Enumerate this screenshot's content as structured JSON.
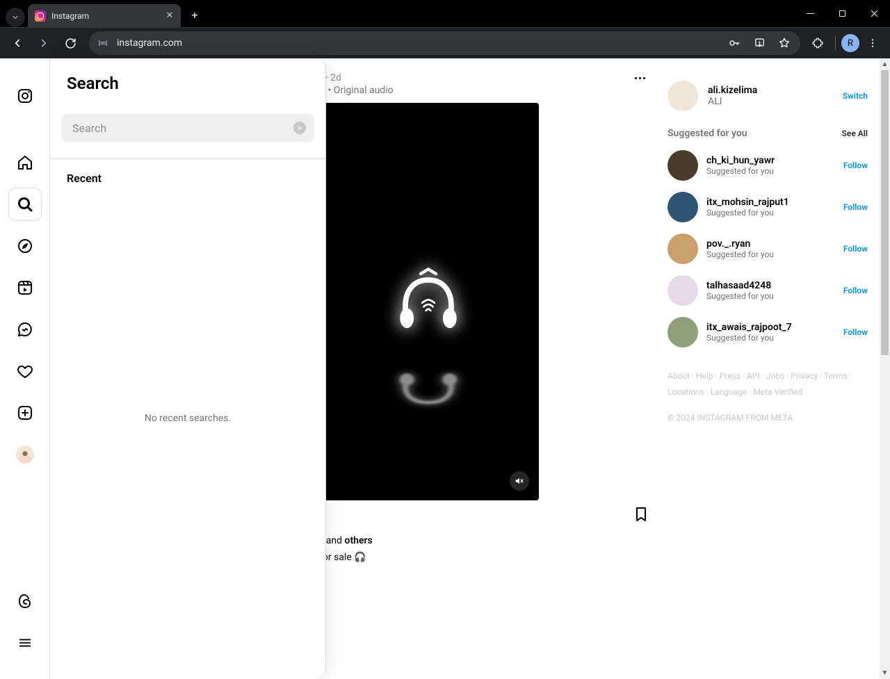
{
  "browser": {
    "tab_title": "Instagram",
    "url": "instagram.com",
    "profile_letter": "R"
  },
  "search_panel": {
    "title": "Search",
    "placeholder": "Search",
    "recent_title": "Recent",
    "no_recent": "No recent searches."
  },
  "post": {
    "time": "2d",
    "audio": "Original audio",
    "likes_tail": "and ",
    "likes_bold": "others",
    "caption": "for sale 🎧"
  },
  "profile": {
    "username": "ali.kizelima",
    "name": "ALI",
    "switch": "Switch"
  },
  "suggested": {
    "title": "Suggested for you",
    "see_all": "See All",
    "items": [
      {
        "username": "ch_ki_hun_yawr",
        "reason": "Suggested for you",
        "cta": "Follow",
        "color": "#4a3c2a"
      },
      {
        "username": "itx_mohsin_rajput1",
        "reason": "Suggested for you",
        "cta": "Follow",
        "color": "#2e5573"
      },
      {
        "username": "pov._.ryan",
        "reason": "Suggested for you",
        "cta": "Follow",
        "color": "#c9a06b"
      },
      {
        "username": "talhasaad4248",
        "reason": "Suggested for you",
        "cta": "Follow",
        "color": "#e8d9e8"
      },
      {
        "username": "itx_awais_rajpoot_7",
        "reason": "Suggested for you",
        "cta": "Follow",
        "color": "#8fa07a"
      }
    ]
  },
  "footer": {
    "links": [
      "About",
      "Help",
      "Press",
      "API",
      "Jobs",
      "Privacy",
      "Terms",
      "Locations",
      "Language",
      "Meta Verified"
    ],
    "copyright": "© 2024 Instagram from Meta"
  }
}
